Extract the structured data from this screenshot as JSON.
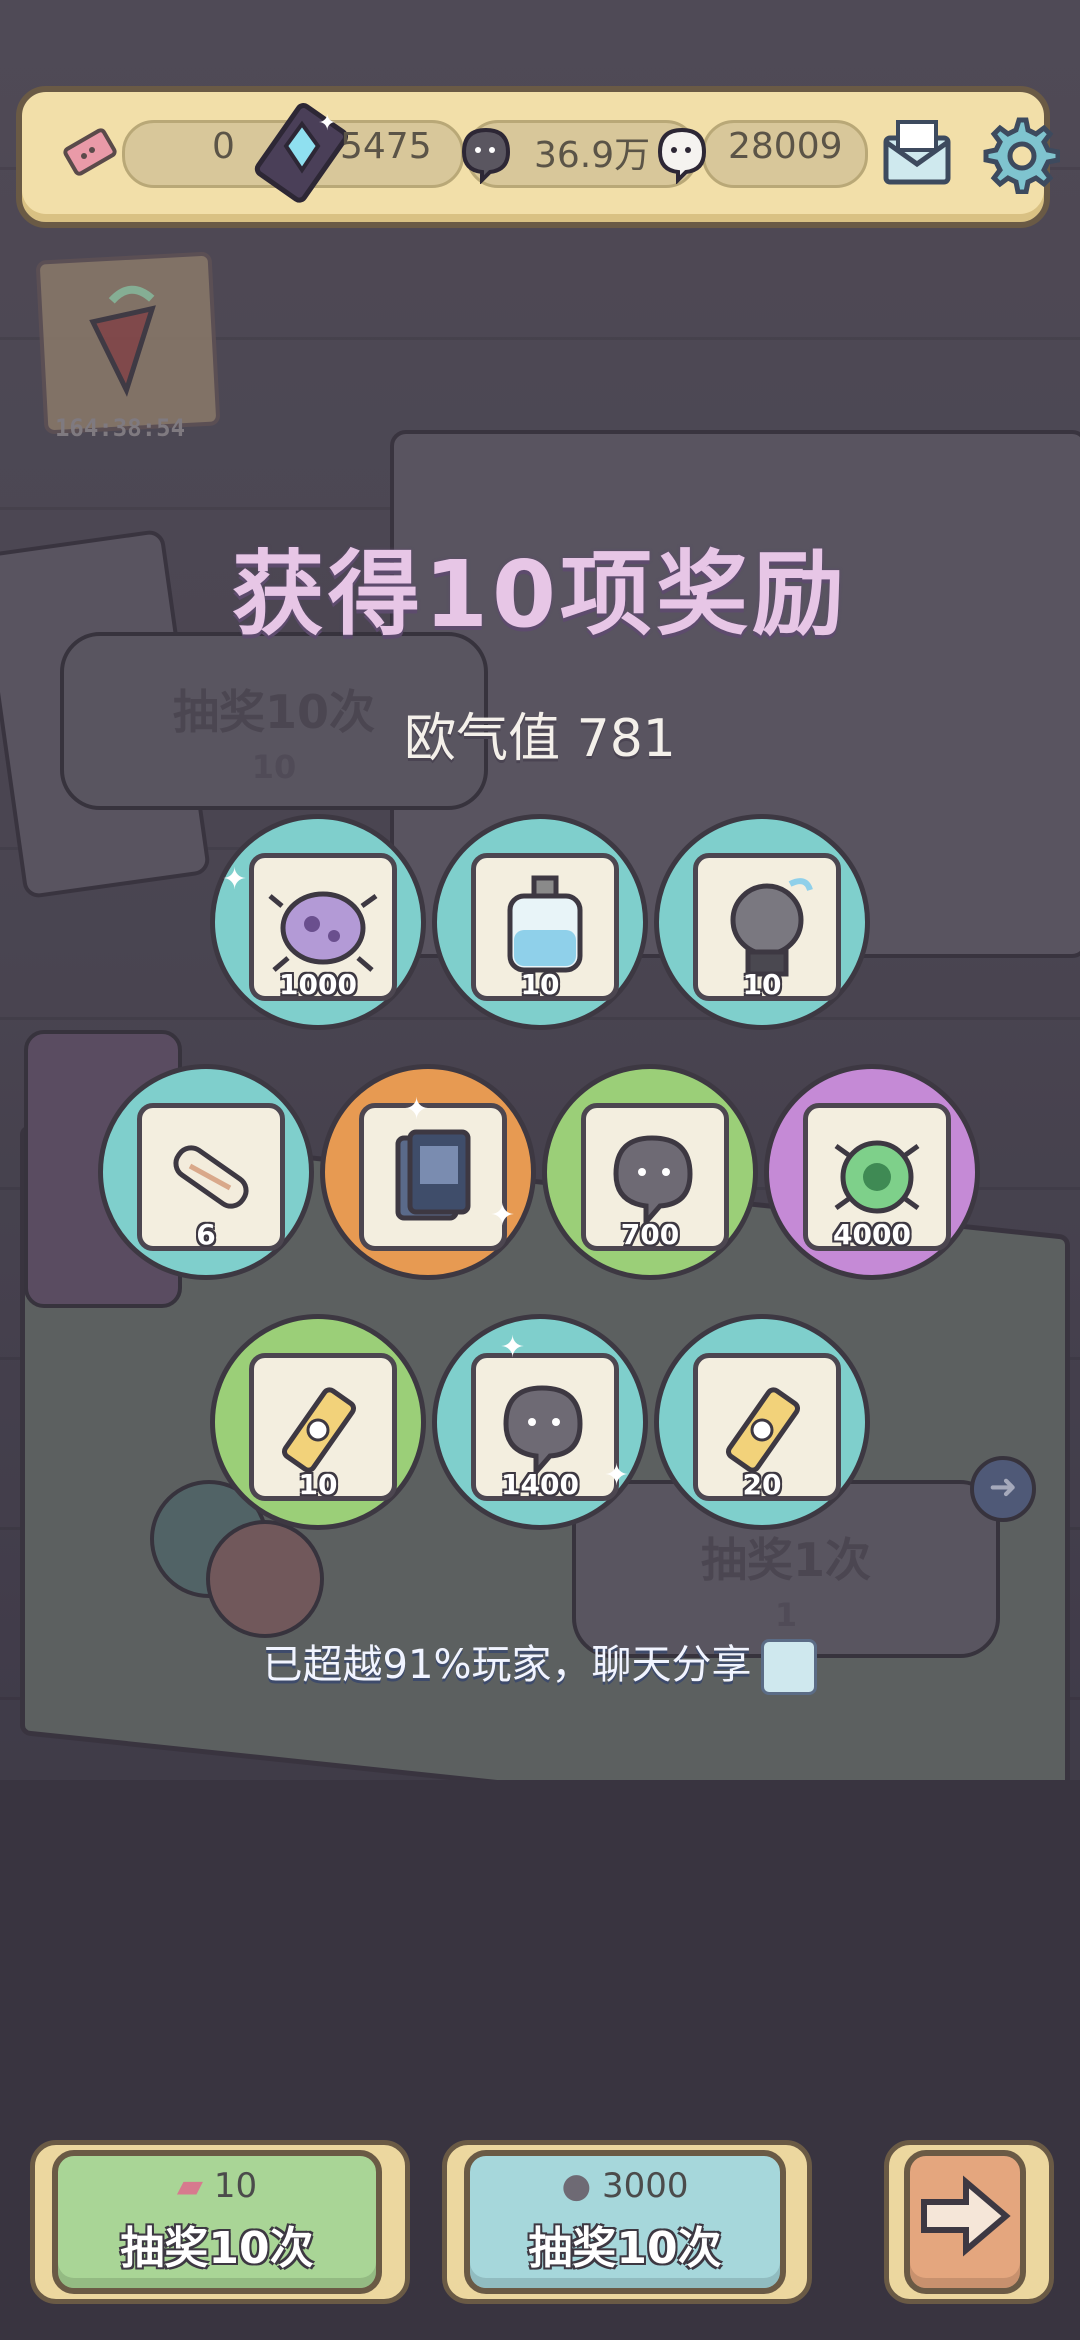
{
  "topbar": {
    "ticket_value": "0",
    "gem_value": "5475",
    "ghost_value": "36.9万",
    "bubble_value": "28009"
  },
  "event": {
    "timer": "164:38:54"
  },
  "result": {
    "title": "获得10项奖励",
    "luck_label": "欧气值 781",
    "share_text": "已超越91%玩家，聊天分享"
  },
  "rewards": [
    {
      "qty": "1000",
      "bg": "#7fcfcc",
      "icon": "purple-microbe-icon"
    },
    {
      "qty": "10",
      "bg": "#7fcfcc",
      "icon": "potion-bottle-icon"
    },
    {
      "qty": "10",
      "bg": "#7fcfcc",
      "icon": "crystal-ball-icon"
    },
    {
      "qty": "6",
      "bg": "#7fcfcc",
      "icon": "scroll-icon"
    },
    {
      "qty": "",
      "bg": "#e79a52",
      "icon": "card-pack-icon"
    },
    {
      "qty": "700",
      "bg": "#9bcf78",
      "icon": "ghost-soul-icon"
    },
    {
      "qty": "4000",
      "bg": "#c58ad6",
      "icon": "green-virus-icon"
    },
    {
      "qty": "10",
      "bg": "#9bcf78",
      "icon": "paint-tube-icon"
    },
    {
      "qty": "1400",
      "bg": "#7fcfcc",
      "icon": "ghost-soul-icon"
    },
    {
      "qty": "20",
      "bg": "#7fcfcc",
      "icon": "paint-tube-icon"
    }
  ],
  "background": {
    "ghost_button_1": "抽奖10次",
    "ghost_button_1_cost": "10",
    "ghost_button_2": "抽奖1次",
    "ghost_button_2_cost": "1"
  },
  "buttons": {
    "draw_ticket_cost": "10",
    "draw_ticket_label": "抽奖10次",
    "draw_ghost_cost": "3000",
    "draw_ghost_label": "抽奖10次"
  }
}
